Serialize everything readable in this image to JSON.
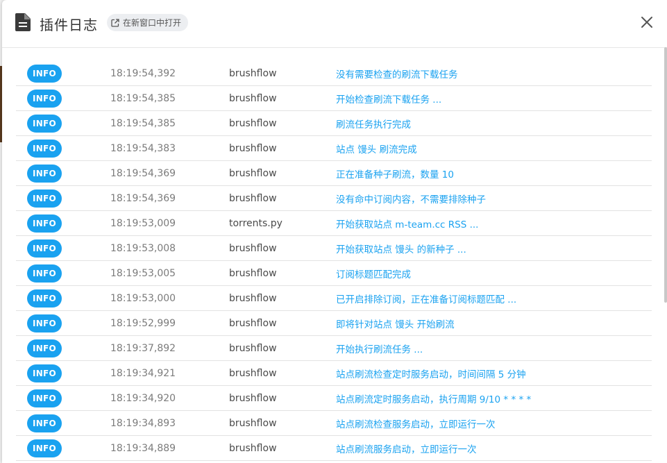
{
  "dialog": {
    "title": "插件日志",
    "open_new_window": "在新窗口中打开",
    "icons": {
      "doc": "file-document-icon",
      "open": "open-in-new-icon",
      "close": "close-icon"
    }
  },
  "colors": {
    "badge": "#1aa2f0",
    "message": "#1aa2f0"
  },
  "logs": [
    {
      "level": "INFO",
      "time": "18:19:54,392",
      "source": "brushflow",
      "message": "没有需要检查的刷流下载任务"
    },
    {
      "level": "INFO",
      "time": "18:19:54,385",
      "source": "brushflow",
      "message": "开始检查刷流下载任务 ..."
    },
    {
      "level": "INFO",
      "time": "18:19:54,385",
      "source": "brushflow",
      "message": "刷流任务执行完成"
    },
    {
      "level": "INFO",
      "time": "18:19:54,383",
      "source": "brushflow",
      "message": "站点 馒头 刷流完成"
    },
    {
      "level": "INFO",
      "time": "18:19:54,369",
      "source": "brushflow",
      "message": "正在准备种子刷流，数量 10"
    },
    {
      "level": "INFO",
      "time": "18:19:54,369",
      "source": "brushflow",
      "message": "没有命中订阅内容，不需要排除种子"
    },
    {
      "level": "INFO",
      "time": "18:19:53,009",
      "source": "torrents.py",
      "message": "开始获取站点 m-team.cc RSS ..."
    },
    {
      "level": "INFO",
      "time": "18:19:53,008",
      "source": "brushflow",
      "message": "开始获取站点 馒头 的新种子 ..."
    },
    {
      "level": "INFO",
      "time": "18:19:53,005",
      "source": "brushflow",
      "message": "订阅标题匹配完成"
    },
    {
      "level": "INFO",
      "time": "18:19:53,000",
      "source": "brushflow",
      "message": "已开启排除订阅，正在准备订阅标题匹配 ..."
    },
    {
      "level": "INFO",
      "time": "18:19:52,999",
      "source": "brushflow",
      "message": "即将针对站点 馒头 开始刷流"
    },
    {
      "level": "INFO",
      "time": "18:19:37,892",
      "source": "brushflow",
      "message": "开始执行刷流任务 ..."
    },
    {
      "level": "INFO",
      "time": "18:19:34,921",
      "source": "brushflow",
      "message": "站点刷流检查定时服务启动，时间间隔 5 分钟"
    },
    {
      "level": "INFO",
      "time": "18:19:34,920",
      "source": "brushflow",
      "message": "站点刷流定时服务启动，执行周期 9/10 * * * *"
    },
    {
      "level": "INFO",
      "time": "18:19:34,893",
      "source": "brushflow",
      "message": "站点刷流检查服务启动，立即运行一次"
    },
    {
      "level": "INFO",
      "time": "18:19:34,889",
      "source": "brushflow",
      "message": "站点刷流服务启动，立即运行一次"
    }
  ]
}
